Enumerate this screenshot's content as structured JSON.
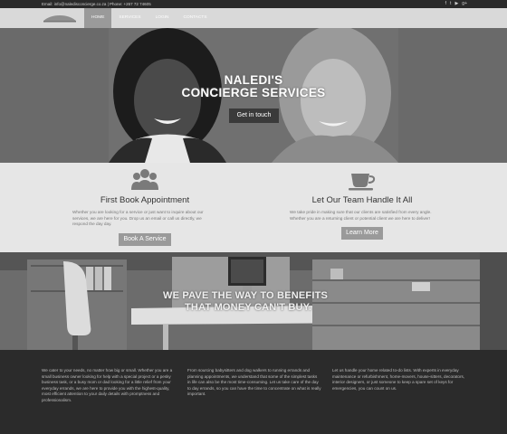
{
  "topbar": {
    "contact": "Email: info@naledisconcierge.co.za | Phone: +267 72 74605",
    "social_icons": [
      "facebook-icon",
      "twitter-icon",
      "youtube-icon",
      "google-plus-icon"
    ],
    "social_glyphs": [
      "f",
      "t",
      "▶",
      "g+"
    ]
  },
  "nav": {
    "items": [
      "Home",
      "Services",
      "Login",
      "Contacts"
    ]
  },
  "hero": {
    "title_line1": "NALEDI'S",
    "title_line2": "CONCIERGE SERVICES",
    "button": "Get in touch"
  },
  "features": [
    {
      "icon": "group-icon",
      "title": "First Book Appointment",
      "text": "Whether you are looking for a service or just want to inquire about our services, we are here for you. Drop us an email or call us directly, we respond the day day.",
      "button": "Book A Service"
    },
    {
      "icon": "coffee-cup-icon",
      "title": "Let Our Team Handle It All",
      "text": "We take pride in making sure that our clients are satisfied from every angle. Whether you are a returning client or potential client we are here to deliver!",
      "button": "Learn More"
    }
  ],
  "banner": {
    "line1": "WE PAVE THE WAY TO BENEFITS",
    "line2": "THAT MONEY CAN'T BUY."
  },
  "footer": {
    "columns": [
      "We cater to your needs, no matter how big or small. Whether you are a small business owner looking for help with a special project or a pesky business task, or a busy mom or dad looking for a little relief from your everyday errands, we are here to provide you with the highest-quality, most efficient attention to your daily details with promptness and professionalism.",
      "From sourcing babysitters and dog walkers to running errands and planning appointments, we understand that some of the simplest tasks in life can also be the most time-consuming. Let us take care of the day to day errands, so you can have the time to concentrate on what is really important.",
      "Let us handle your home related to-do lists. With experts in everyday maintenance or refurbishment, home-movers, house-sitters, decorators, interior designers, or just someone to keep a spare set of keys for emergencies, you can count on us."
    ]
  }
}
